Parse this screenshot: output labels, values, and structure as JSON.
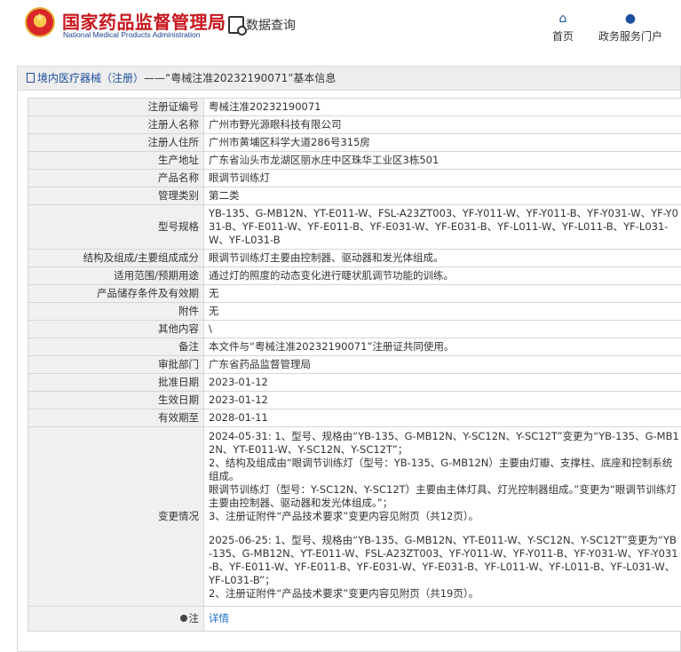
{
  "header": {
    "brand_cn": "国家药品监督管理局",
    "brand_en": "National Medical Products Administration",
    "query_label": "数据查询",
    "nav": [
      {
        "label": "首页",
        "icon": "home-icon"
      },
      {
        "label": "政务服务门户",
        "icon": "user-icon"
      }
    ]
  },
  "panel": {
    "title_link": "境内医疗器械（注册）",
    "title_rest": "——“粤械注准20232190071”基本信息"
  },
  "rows": [
    {
      "key": "注册证编号",
      "value": "粤械注准20232190071"
    },
    {
      "key": "注册人名称",
      "value": "广州市野光源眼科技有限公司"
    },
    {
      "key": "注册人住所",
      "value": "广州市黄埔区科学大道286号315房"
    },
    {
      "key": "生产地址",
      "value": "广东省汕头市龙湖区丽水庄中区珠华工业区3栋501"
    },
    {
      "key": "产品名称",
      "value": "眼调节训练灯"
    },
    {
      "key": "管理类别",
      "value": "第二类"
    },
    {
      "key": "型号规格",
      "value": "YB-135、G-MB12N、YT-E011-W、FSL-A23ZT003、YF-Y011-W、YF-Y011-B、YF-Y031-W、YF-Y031-B、YF-E011-W、YF-E011-B、YF-E031-W、YF-E031-B、YF-L011-W、YF-L011-B、YF-L031-W、YF-L031-B"
    },
    {
      "key": "结构及组成/主要组成成分",
      "value": "眼调节训练灯主要由控制器、驱动器和发光体组成。"
    },
    {
      "key": "适用范围/预期用途",
      "value": "通过灯的照度的动态变化进行睫状肌调节功能的训练。"
    },
    {
      "key": "产品储存条件及有效期",
      "value": "无"
    },
    {
      "key": "附件",
      "value": "无"
    },
    {
      "key": "其他内容",
      "value": "\\"
    },
    {
      "key": "备注",
      "value": "本文件与“粤械注准20232190071”注册证共同使用。"
    },
    {
      "key": "审批部门",
      "value": "广东省药品监督管理局"
    },
    {
      "key": "批准日期",
      "value": "2023-01-12"
    },
    {
      "key": "生效日期",
      "value": "2023-01-12"
    },
    {
      "key": "有效期至",
      "value": "2028-01-11"
    }
  ],
  "changes": {
    "key": "变更情况",
    "lines": [
      "2024-05-31: 1、型号、规格由“YB-135、G-MB12N、Y-SC12N、Y-SC12T”变更为“YB-135、G-MB12N、YT-E011-W、Y-SC12N、Y-SC12T”；",
      "2、结构及组成由“眼调节训练灯（型号：YB-135、G-MB12N）主要由灯瓣、支撑柱、底座和控制系统组成。",
      "眼调节训练灯（型号：Y-SC12N、Y-SC12T）主要由主体灯具、灯光控制器组成。”变更为“眼调节训练灯主要由控制器、驱动器和发光体组成。”；",
      "3、注册证附件“产品技术要求”变更内容见附页（共12页）。",
      "2025-06-25: 1、型号、规格由“YB-135、G-MB12N、YT-E011-W、Y-SC12N、Y-SC12T”变更为“YB-135、G-MB12N、YT-E011-W、FSL-A23ZT003、YF-Y011-W、YF-Y011-B、YF-Y031-W、YF-Y031-B、YF-E011-W、YF-E011-B、YF-E031-W、YF-E031-B、YF-L011-W、YF-L011-B、YF-L031-W、YF-L031-B”；",
      "2、注册证附件“产品技术要求”变更内容见附页（共19页）。"
    ]
  },
  "notes": {
    "key": "注",
    "link": "详情"
  },
  "colors": {
    "brand_red": "#c8161d",
    "brand_blue": "#1c4f9f",
    "link_blue": "#1c6fce"
  }
}
